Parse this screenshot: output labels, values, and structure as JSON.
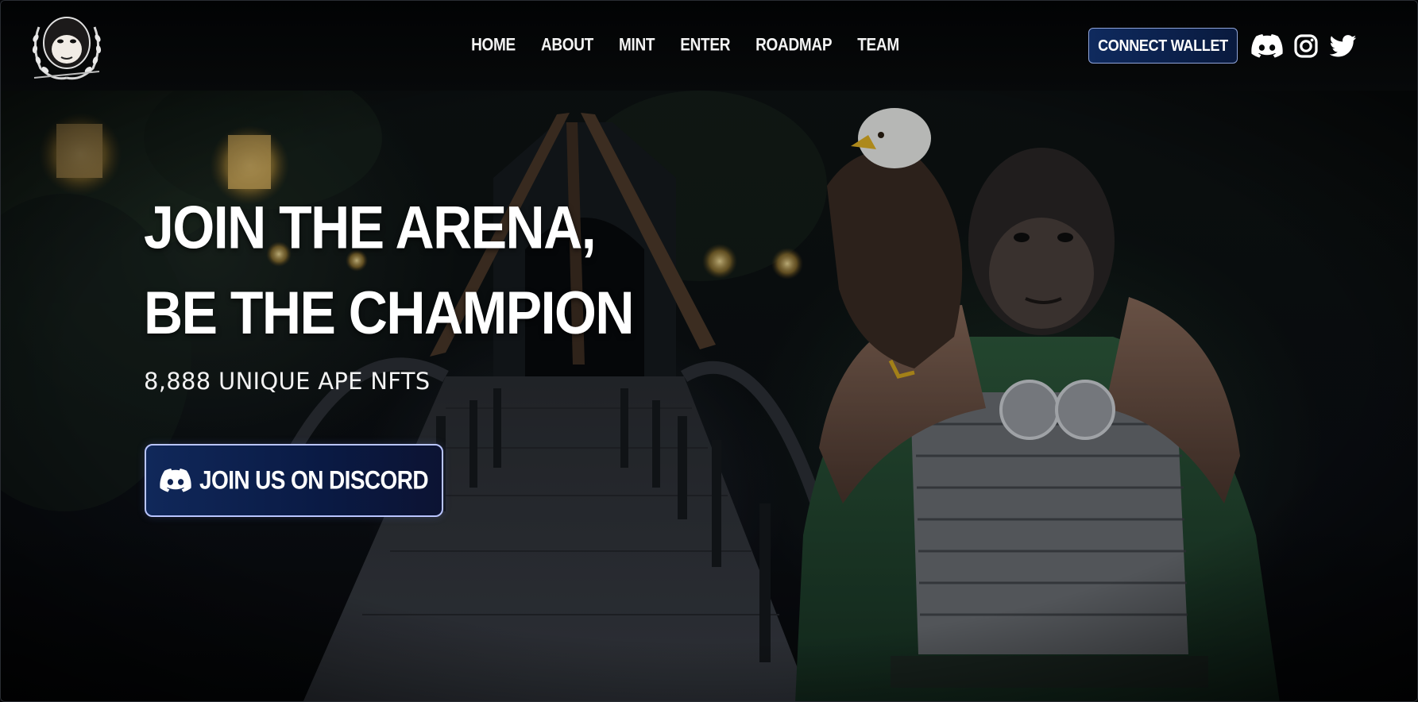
{
  "nav": {
    "items": [
      {
        "label": "HOME"
      },
      {
        "label": "ABOUT"
      },
      {
        "label": "MINT"
      },
      {
        "label": "ENTER"
      },
      {
        "label": "ROADMAP"
      },
      {
        "label": "TEAM"
      }
    ]
  },
  "header": {
    "connect_wallet_label": "CONNECT WALLET",
    "social_icons": [
      "discord-icon",
      "instagram-icon",
      "twitter-icon"
    ]
  },
  "hero": {
    "title_line1": "JOIN THE ARENA,",
    "title_line2": "BE THE CHAMPION",
    "subtitle": "8,888 UNIQUE APE NFTS",
    "discord_button_label": "JOIN US ON DISCORD"
  },
  "colors": {
    "button_bg": "#0f2a5e",
    "button_border": "#b9c5ff",
    "header_bg": "#030405"
  }
}
